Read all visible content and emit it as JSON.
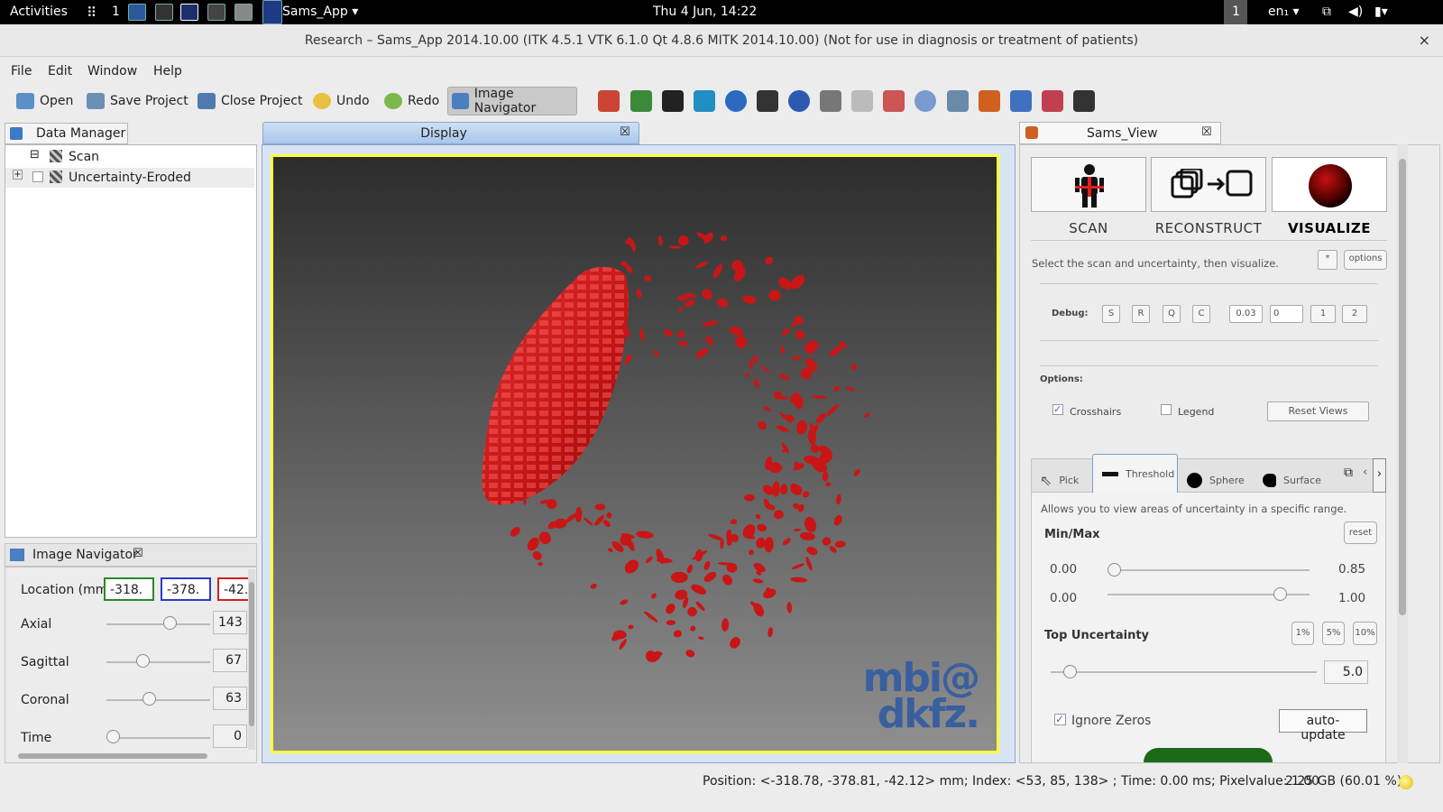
{
  "topbar": {
    "activities": "Activities",
    "workspace": "1",
    "app_menu": "Sams_App ▾",
    "clock": "Thu  4 Jun, 14:22",
    "indicator": "1",
    "lang": "en₁ ▾"
  },
  "window": {
    "title": "Research – Sams_App 2014.10.00 (ITK 4.5.1  VTK 6.1.0 Qt 4.8.6 MITK 2014.10.00) (Not for use in diagnosis or treatment of patients)",
    "close": "×"
  },
  "menu": [
    "File",
    "Edit",
    "Window",
    "Help"
  ],
  "toolbar": {
    "open": "Open",
    "save_project": "Save Project",
    "close_project": "Close Project",
    "undo": "Undo",
    "redo": "Redo",
    "image_navigator": "Image Navigator"
  },
  "data_manager": {
    "tab": "Data Manager",
    "items": [
      {
        "label": "Scan",
        "expander": "⊟"
      },
      {
        "label": "Uncertainty-Eroded",
        "expander": "+"
      }
    ]
  },
  "image_navigator": {
    "tab": "Image Navigator",
    "location_label": "Location (mm)",
    "location": [
      "-318.",
      "-378.",
      "-42."
    ],
    "rows": [
      {
        "label": "Axial",
        "value": "143",
        "level": 0.58
      },
      {
        "label": "Sagittal",
        "value": "67",
        "level": 0.31
      },
      {
        "label": "Coronal",
        "value": "63",
        "level": 0.37
      },
      {
        "label": "Time",
        "value": "0",
        "level": 0.0
      }
    ]
  },
  "display": {
    "tab": "Display",
    "watermark_line1": "mbi@",
    "watermark_line2": "dkfz."
  },
  "sams_view": {
    "tab": "Sams_View",
    "steps": [
      {
        "label": "SCAN",
        "icon": "person-icon"
      },
      {
        "label": "RECONSTRUCT",
        "icon": "reconstruct-icon"
      },
      {
        "label": "VISUALIZE",
        "icon": "sphere-icon"
      }
    ],
    "instruction": "Select the scan and uncertainty, then visualize.",
    "star_btn": "*",
    "options_btn": "options",
    "debug_label": "Debug:",
    "debug_buttons": [
      "S",
      "R",
      "Q",
      "C"
    ],
    "debug_fields": [
      "0.03",
      "0"
    ],
    "debug_nums": [
      "1",
      "2"
    ],
    "options_label": "Options:",
    "crosshairs": "Crosshairs",
    "crosshairs_checked": true,
    "legend": "Legend",
    "reset_views": "Reset Views",
    "tabs": [
      "Pick",
      "Threshold",
      "Sphere",
      "Surface"
    ],
    "active_tab": "Threshold",
    "threshold_desc": "Allows you to view areas of uncertainty in a specific range.",
    "minmax_label": "Min/Max",
    "reset_btn": "reset",
    "min_row": {
      "left": "0.00",
      "right": "0.85",
      "level": 0.0
    },
    "max_row": {
      "left": "0.00",
      "right": "1.00",
      "level": 0.85
    },
    "top_uncertainty_label": "Top Uncertainty",
    "pct_buttons": [
      "1%",
      "5%",
      "10%"
    ],
    "top_value": "5.0",
    "top_level": 0.05,
    "ignore_zeros": "Ignore Zeros",
    "ignore_zeros_checked": true,
    "auto_update": "auto-update"
  },
  "status": {
    "text": "Position: <-318.78, -378.81, -42.12> mm; Index: <53, 85, 138> ; Time: 0.00 ms; Pixelvalue: 1.00",
    "memory": "2.25 GB (60.01 %)"
  },
  "colors": {
    "render_border": "#ffff33",
    "mesh": "#d01818",
    "watermark": "#3a5f9e"
  }
}
